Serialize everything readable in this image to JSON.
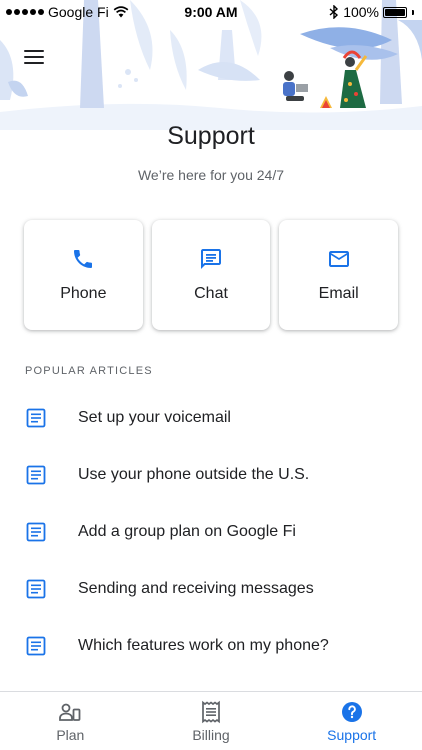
{
  "status_bar": {
    "carrier": "Google Fi",
    "time": "9:00 AM",
    "battery": "100%",
    "battery_level": 1.0
  },
  "header": {
    "title": "Support",
    "subtitle": "We’re here for you 24/7"
  },
  "contact": [
    {
      "label": "Phone",
      "icon": "phone-icon"
    },
    {
      "label": "Chat",
      "icon": "chat-icon"
    },
    {
      "label": "Email",
      "icon": "email-icon"
    }
  ],
  "articles": {
    "heading": "POPULAR ARTICLES",
    "items": [
      {
        "title": "Set up your voicemail"
      },
      {
        "title": "Use your phone outside the U.S."
      },
      {
        "title": "Add a group plan on Google Fi"
      },
      {
        "title": "Sending and receiving messages"
      },
      {
        "title": "Which features work on my phone?"
      }
    ]
  },
  "bottom_nav": {
    "items": [
      {
        "label": "Plan",
        "icon": "plan-icon"
      },
      {
        "label": "Billing",
        "icon": "billing-icon"
      },
      {
        "label": "Support",
        "icon": "help-icon"
      }
    ],
    "active": "Support"
  },
  "colors": {
    "accent": "#1a73e8",
    "text": "#202124",
    "secondary_text": "#5f6368",
    "illustration_blue": "#a9c1ec"
  }
}
